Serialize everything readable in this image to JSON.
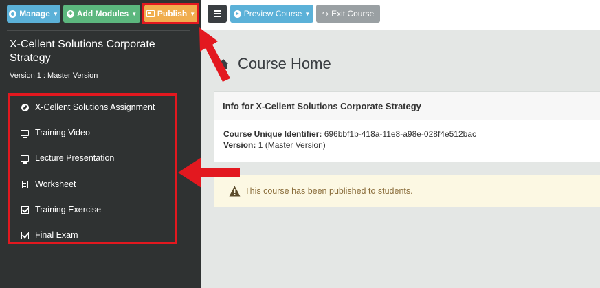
{
  "colors": {
    "sidebar_bg": "#2f3232",
    "manage_btn": "#5bb1d8",
    "add_modules_btn": "#5cb77e",
    "publish_btn": "#f0ad4e",
    "annotation_red": "#e3181f",
    "alert_bg": "#fcf8e3",
    "alert_text": "#8a6d3b"
  },
  "toolbar": {
    "manage_label": "Manage",
    "add_modules_label": "Add Modules",
    "publish_label": "Publish",
    "preview_label": "Preview Course",
    "exit_label": "Exit Course"
  },
  "sidebar": {
    "course_title": "X-Cellent Solutions Corporate Strategy",
    "version": "Version 1 : Master Version",
    "items": [
      {
        "label": "X-Cellent Solutions Assignment",
        "icon": "compass-icon"
      },
      {
        "label": "Training Video",
        "icon": "monitor-icon"
      },
      {
        "label": "Lecture Presentation",
        "icon": "monitor-icon"
      },
      {
        "label": "Worksheet",
        "icon": "document-icon"
      },
      {
        "label": "Training Exercise",
        "icon": "checkbox-icon"
      },
      {
        "label": "Final Exam",
        "icon": "checkbox-icon"
      }
    ]
  },
  "main": {
    "page_title": "Course Home",
    "info_heading": "Info for X-Cellent Solutions Corporate Strategy",
    "identifier_label": "Course Unique Identifier:",
    "identifier_value": "696bbf1b-418a-11e8-a98e-028f4e512bac",
    "version_label": "Version:",
    "version_value": "1 (Master Version)",
    "alert_text": "This course has been published to students."
  }
}
